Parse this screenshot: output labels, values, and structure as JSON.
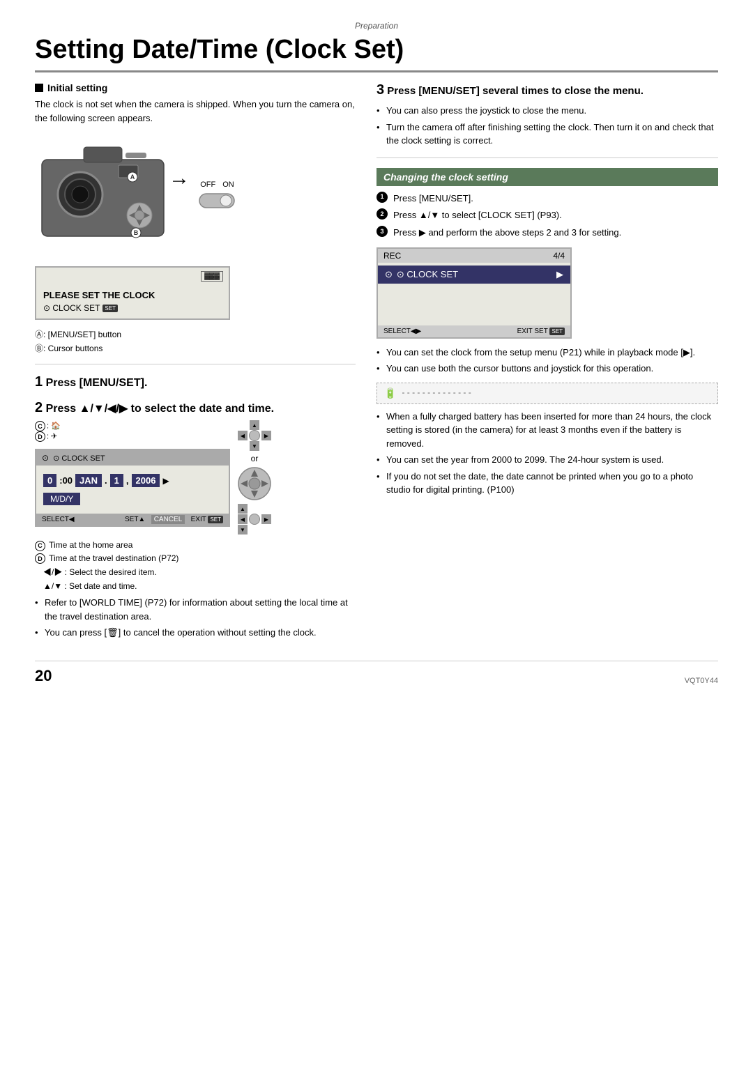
{
  "meta": {
    "section_label": "Preparation",
    "page_title": "Setting Date/Time (Clock Set)",
    "page_number": "20",
    "doc_code": "VQT0Y44"
  },
  "left_col": {
    "initial_setting": {
      "heading": "Initial setting",
      "body1": "The clock is not set when the camera is shipped. When you turn the camera on, the following screen appears.",
      "lcd": {
        "battery_icon": "▓▓▓",
        "main_text": "PLEASE SET THE CLOCK",
        "sub_text": "⊙ CLOCK SET",
        "set_badge": "SET"
      },
      "label_a": "Ⓐ: [MENU/SET] button",
      "label_b": "Ⓑ: Cursor buttons",
      "switch_labels": [
        "OFF",
        "ON"
      ]
    },
    "step1": {
      "number": "1",
      "text": "Press [MENU/SET]."
    },
    "step2": {
      "number": "2",
      "text": "Press ▲/▼/◀/▶ to select the date and time.",
      "clockset_header": "⊙ CLOCK SET",
      "label_c": "Ⓒ: Time at the home area",
      "label_d": "Ⓓ: Time at the travel destination (P72)",
      "label_select": "◀/▶ : Select the desired item.",
      "label_set": "▲/▼ : Set date and time.",
      "bullets": [
        "Refer to [WORLD TIME] (P72) for information about setting the local time at the travel destination area.",
        "You can press [🗑] to cancel the operation without setting the clock."
      ],
      "date_value": "0:00  JAN. 1, 2006",
      "mdy_label": "M/D/Y",
      "cancel_label": "CANCEL",
      "select_label": "SELECT◀",
      "set_label": "SET▲",
      "exit_label": "EXIT"
    }
  },
  "right_col": {
    "step3": {
      "number": "3",
      "text": "Press [MENU/SET] several times to close the menu.",
      "bullets": [
        "You can also press the joystick to close the menu.",
        "Turn the camera off after finishing setting the clock. Then turn it on and check that the clock setting is correct."
      ]
    },
    "changing_clock": {
      "heading": "Changing the clock setting",
      "instructions": [
        "Press [MENU/SET].",
        "Press ▲/▼ to select [CLOCK SET] (P93).",
        "Press ▶ and perform the above steps 2 and 3 for setting."
      ],
      "rec_menu": {
        "header_left": "REC",
        "header_right": "4/4",
        "item_clock": "⊙ CLOCK SET",
        "select_label": "SELECT◀▶",
        "exit_label": "EXIT SET"
      }
    },
    "notes": [
      "You can set the clock from the setup menu (P21) while in playback mode [▶].",
      "You can use both the cursor buttons and joystick for this operation.",
      "When a fully charged battery has been inserted for more than 24 hours, the clock setting is stored (in the camera) for at least 3 months even if the battery is removed.",
      "You can set the year from 2000 to 2099. The 24-hour system is used.",
      "If you do not set the date, the date cannot be printed when you go to a photo studio for digital printing. (P100)"
    ]
  }
}
